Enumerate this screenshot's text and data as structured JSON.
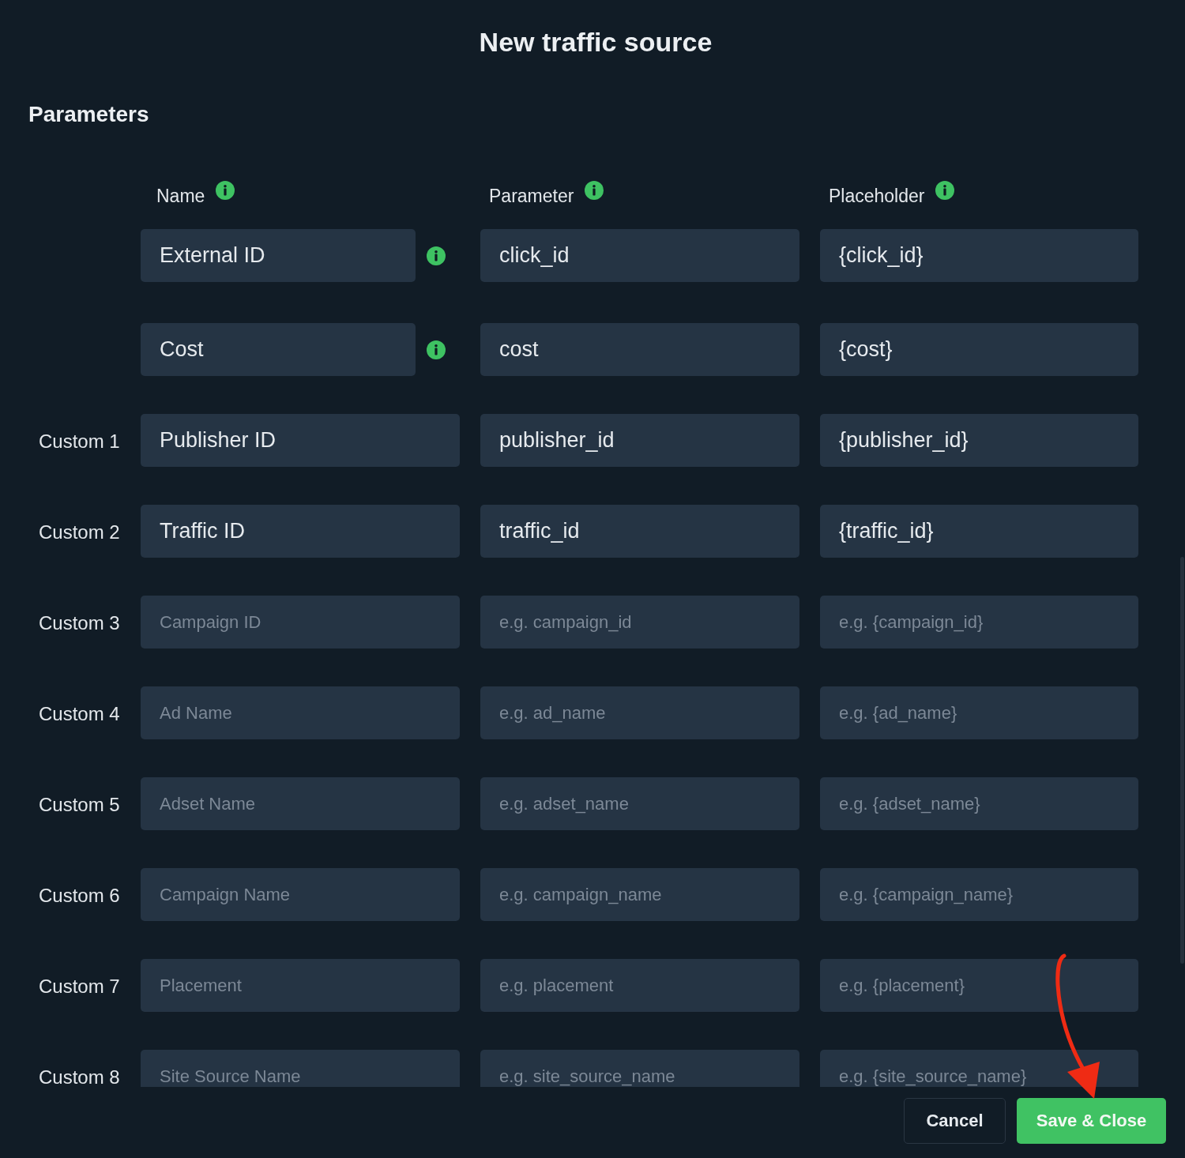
{
  "dialog": {
    "title": "New traffic source"
  },
  "section": {
    "title": "Parameters"
  },
  "columns": [
    {
      "label": "Name",
      "info": true
    },
    {
      "label": "Parameter",
      "info": true
    },
    {
      "label": "Placeholder",
      "info": true
    }
  ],
  "rows": [
    {
      "info": true,
      "name_field": {
        "value": "External ID"
      },
      "parameter_field": {
        "value": "click_id"
      },
      "placeholder_field": {
        "value": "{click_id}"
      }
    },
    {
      "info": true,
      "name_field": {
        "value": "Cost"
      },
      "parameter_field": {
        "value": "cost"
      },
      "placeholder_field": {
        "value": "{cost}"
      }
    },
    {
      "label": "Custom 1",
      "info": false,
      "name_field": {
        "value": "Publisher ID"
      },
      "parameter_field": {
        "value": "publisher_id"
      },
      "placeholder_field": {
        "value": "{publisher_id}"
      }
    },
    {
      "label": "Custom 2",
      "info": false,
      "name_field": {
        "value": "Traffic ID"
      },
      "parameter_field": {
        "value": "traffic_id"
      },
      "placeholder_field": {
        "value": "{traffic_id}"
      }
    },
    {
      "label": "Custom 3",
      "info": false,
      "name_field": {
        "placeholder": "Campaign ID"
      },
      "parameter_field": {
        "placeholder": "e.g. campaign_id"
      },
      "placeholder_field": {
        "placeholder": "e.g. {campaign_id}"
      }
    },
    {
      "label": "Custom 4",
      "info": false,
      "name_field": {
        "placeholder": "Ad Name"
      },
      "parameter_field": {
        "placeholder": "e.g. ad_name"
      },
      "placeholder_field": {
        "placeholder": "e.g. {ad_name}"
      }
    },
    {
      "label": "Custom 5",
      "info": false,
      "name_field": {
        "placeholder": "Adset Name"
      },
      "parameter_field": {
        "placeholder": "e.g. adset_name"
      },
      "placeholder_field": {
        "placeholder": "e.g. {adset_name}"
      }
    },
    {
      "label": "Custom 6",
      "info": false,
      "name_field": {
        "placeholder": "Campaign Name"
      },
      "parameter_field": {
        "placeholder": "e.g. campaign_name"
      },
      "placeholder_field": {
        "placeholder": "e.g. {campaign_name}"
      }
    },
    {
      "label": "Custom 7",
      "info": false,
      "name_field": {
        "placeholder": "Placement"
      },
      "parameter_field": {
        "placeholder": "e.g. placement"
      },
      "placeholder_field": {
        "placeholder": "e.g. {placement}"
      }
    },
    {
      "label": "Custom 8",
      "info": false,
      "name_field": {
        "placeholder": "Site Source Name"
      },
      "parameter_field": {
        "placeholder": "e.g. site_source_name"
      },
      "placeholder_field": {
        "placeholder": "e.g. {site_source_name}"
      }
    }
  ],
  "buttons": [
    {
      "label": "Cancel",
      "kind": "secondary"
    },
    {
      "label": "Save & Close",
      "kind": "primary"
    }
  ]
}
